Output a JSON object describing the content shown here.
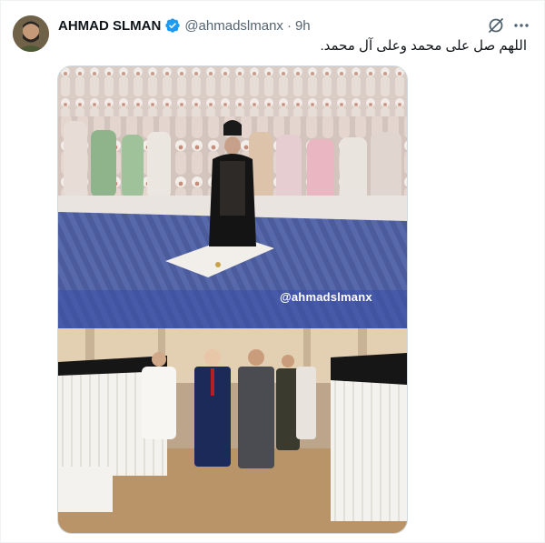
{
  "post": {
    "author_name": "AHMAD SLMAN",
    "handle": "@ahmadslmanx",
    "separator": "·",
    "time": "9h",
    "text": "اللهم صل على محمد وعلى آل محمد."
  },
  "media": {
    "watermark": "@ahmadslmanx"
  },
  "icons": {
    "verified": "verified-badge-icon",
    "grok": "grok-icon",
    "more": "more-options-icon"
  },
  "colors": {
    "verified_blue": "#1d9bf0",
    "secondary_text": "#536471",
    "banner_blue": "#3b4fa8"
  }
}
